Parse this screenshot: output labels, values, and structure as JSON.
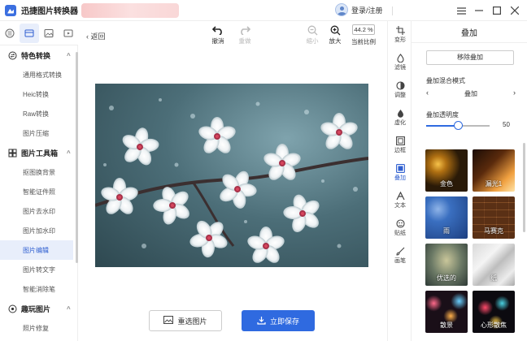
{
  "titlebar": {
    "app_name": "迅捷图片转换器",
    "login_label": "登录/注册"
  },
  "sidebar": {
    "groups": [
      {
        "label": "特色转换",
        "items": [
          "通用格式转换",
          "Heic转换",
          "Raw转换",
          "图片压缩"
        ]
      },
      {
        "label": "图片工具箱",
        "items": [
          "抠图换背景",
          "智能证件照",
          "图片去水印",
          "图片加水印",
          "图片编辑",
          "图片转文字",
          "智能消除笔"
        ]
      },
      {
        "label": "趣玩图片",
        "items": [
          "照片修复"
        ]
      }
    ],
    "active_item": "图片编辑"
  },
  "toolbar": {
    "back_label": "返回",
    "undo_label": "撤消",
    "redo_label": "重做",
    "zoom_out_label": "缩小",
    "zoom_in_label": "放大",
    "zoom_value": "44.2 %",
    "zoom_caption": "当前比例"
  },
  "canvas": {
    "reselect_label": "重选图片",
    "save_label": "立即保存"
  },
  "right_tools": [
    {
      "label": "变形",
      "icon": "crop-icon"
    },
    {
      "label": "滤镜",
      "icon": "filter-icon"
    },
    {
      "label": "调整",
      "icon": "adjust-icon"
    },
    {
      "label": "虚化",
      "icon": "blur-icon"
    },
    {
      "label": "边框",
      "icon": "frame-icon"
    },
    {
      "label": "叠加",
      "icon": "overlay-icon"
    },
    {
      "label": "文本",
      "icon": "text-icon"
    },
    {
      "label": "贴纸",
      "icon": "sticker-icon"
    },
    {
      "label": "画笔",
      "icon": "brush-icon"
    }
  ],
  "active_tool": "叠加",
  "panel": {
    "title": "叠加",
    "remove_label": "移除叠加",
    "mode_label": "叠加混合模式",
    "mode_value": "叠加",
    "opacity_label": "叠加透明度",
    "opacity_value": "50",
    "opacity_fraction": 0.5,
    "overlays": [
      "金色",
      "漏光1",
      "雨",
      "马赛克",
      "优选的",
      "纸",
      "散景",
      "心形散焦"
    ]
  },
  "colors": {
    "accent": "#2f6ae0",
    "active_bg": "#e8eefb"
  }
}
